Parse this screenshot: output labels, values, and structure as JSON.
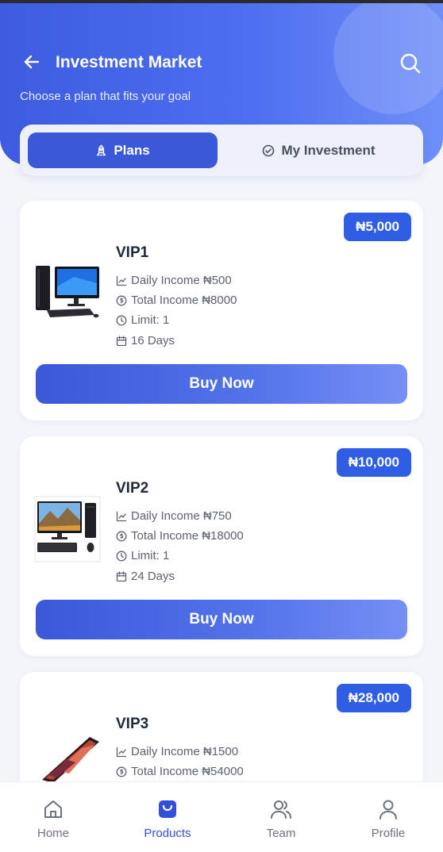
{
  "header": {
    "title": "Investment Market",
    "subtitle": "Choose a plan that fits your goal"
  },
  "tabs": [
    {
      "label": "Plans",
      "active": true
    },
    {
      "label": "My Investment",
      "active": false
    }
  ],
  "plans": [
    {
      "name": "VIP1",
      "price": "₦5,000",
      "daily_income": "Daily Income ₦500",
      "total_income": "Total Income ₦8000",
      "limit": "Limit: 1",
      "duration": "16 Days",
      "button": "Buy Now"
    },
    {
      "name": "VIP2",
      "price": "₦10,000",
      "daily_income": "Daily Income ₦750",
      "total_income": "Total Income ₦18000",
      "limit": "Limit: 1",
      "duration": "24 Days",
      "button": "Buy Now"
    },
    {
      "name": "VIP3",
      "price": "₦28,000",
      "daily_income": "Daily Income ₦1500",
      "total_income": "Total Income ₦54000"
    }
  ],
  "bottom_nav": [
    {
      "label": "Home",
      "icon": "home-icon",
      "active": false
    },
    {
      "label": "Products",
      "icon": "shopping-bag-icon",
      "active": true
    },
    {
      "label": "Team",
      "icon": "team-icon",
      "active": false
    },
    {
      "label": "Profile",
      "icon": "profile-icon",
      "active": false
    }
  ],
  "colors": {
    "primary": "#3a58d8",
    "badge": "#2f5ee4",
    "background": "#f3f5fb"
  }
}
